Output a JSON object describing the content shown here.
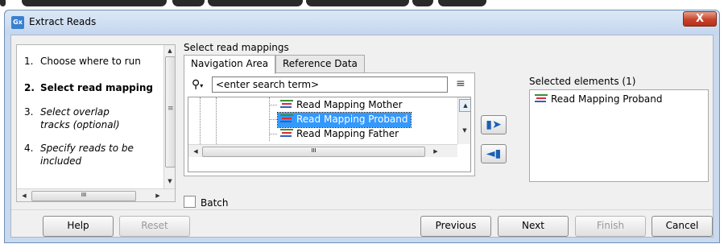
{
  "window": {
    "app_icon": "Gx",
    "title": "Extract Reads",
    "close_glyph": "X"
  },
  "steps": [
    {
      "num": "1.",
      "label": "Choose where to run"
    },
    {
      "num": "2.",
      "label": "Select read mapping"
    },
    {
      "num": "3.",
      "label": "Select overlap tracks (optional)"
    },
    {
      "num": "4.",
      "label": "Specify reads to be included"
    }
  ],
  "mappings": {
    "section_label": "Select read mappings",
    "tabs": [
      "Navigation Area",
      "Reference Data"
    ],
    "active_tab": "Navigation Area",
    "search_placeholder": "<enter search term>",
    "tree_items": [
      "Read Mapping Mother",
      "Read Mapping Proband",
      "Read Mapping Father"
    ],
    "selected_tree_item": "Read Mapping Proband"
  },
  "selected": {
    "label": "Selected elements (1)",
    "items": [
      "Read Mapping Proband"
    ]
  },
  "batch": {
    "label": "Batch",
    "checked": false
  },
  "buttons": {
    "help": "Help",
    "reset": "Reset",
    "previous": "Previous",
    "next": "Next",
    "finish": "Finish",
    "cancel": "Cancel"
  },
  "scrollbar_glyph": "III",
  "colors": {
    "selection": "#3399ff",
    "close_button": "#c7432a",
    "move_arrow": "#1a5fb4"
  }
}
